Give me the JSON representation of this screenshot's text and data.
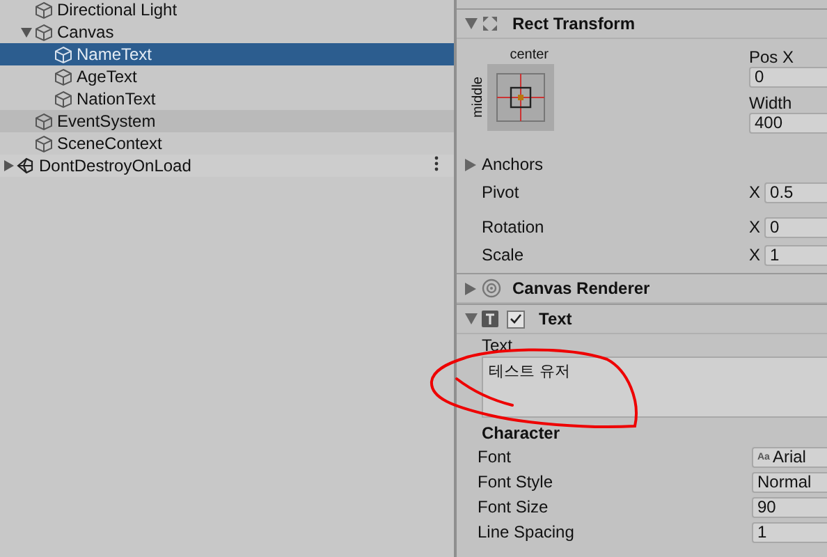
{
  "hierarchy": {
    "items": [
      {
        "label": "Directional Light",
        "kind": "object",
        "selected": false,
        "highlighted": false
      },
      {
        "label": "Canvas",
        "kind": "object",
        "selected": false,
        "highlighted": false,
        "expanded": true,
        "children": [
          {
            "label": "NameText",
            "kind": "object",
            "selected": true,
            "highlighted": false
          },
          {
            "label": "AgeText",
            "kind": "object",
            "selected": false,
            "highlighted": false
          },
          {
            "label": "NationText",
            "kind": "object",
            "selected": false,
            "highlighted": false
          }
        ]
      },
      {
        "label": "EventSystem",
        "kind": "object",
        "selected": false,
        "highlighted": true
      },
      {
        "label": "SceneContext",
        "kind": "object",
        "selected": false,
        "highlighted": false
      },
      {
        "label": "DontDestroyOnLoad",
        "kind": "scene",
        "selected": false,
        "highlighted": false,
        "expanded": false
      }
    ]
  },
  "inspector": {
    "components": [
      {
        "kind": "rect_transform",
        "title": "Rect Transform",
        "expanded": true,
        "anchor_horizontal": "center",
        "anchor_vertical": "middle",
        "fields": [
          {
            "label": "Pos X",
            "value": "0"
          },
          {
            "label": "Width",
            "value": "400"
          }
        ],
        "anchors": {
          "label": "Anchors",
          "expanded": false
        },
        "rows": [
          {
            "label": "Pivot",
            "axis": "X",
            "value": "0.5"
          },
          {
            "label": "Rotation",
            "axis": "X",
            "value": "0"
          },
          {
            "label": "Scale",
            "axis": "X",
            "value": "1"
          }
        ]
      },
      {
        "kind": "canvas_renderer",
        "title": "Canvas Renderer",
        "expanded": false
      },
      {
        "kind": "text",
        "title": "Text",
        "expanded": true,
        "enabled": true,
        "text_label": "Text",
        "text_value": "테스트 유저",
        "section": "Character",
        "properties": [
          {
            "label": "Font",
            "kind": "font",
            "icon": "Aa",
            "value": "Arial"
          },
          {
            "label": "Font Style",
            "kind": "dropdown",
            "value": "Normal"
          },
          {
            "label": "Font Size",
            "kind": "field",
            "value": "90"
          },
          {
            "label": "Line Spacing",
            "kind": "field",
            "value": "1"
          }
        ]
      }
    ]
  },
  "annotations": [
    {
      "kind": "freehand_ellipse"
    }
  ]
}
